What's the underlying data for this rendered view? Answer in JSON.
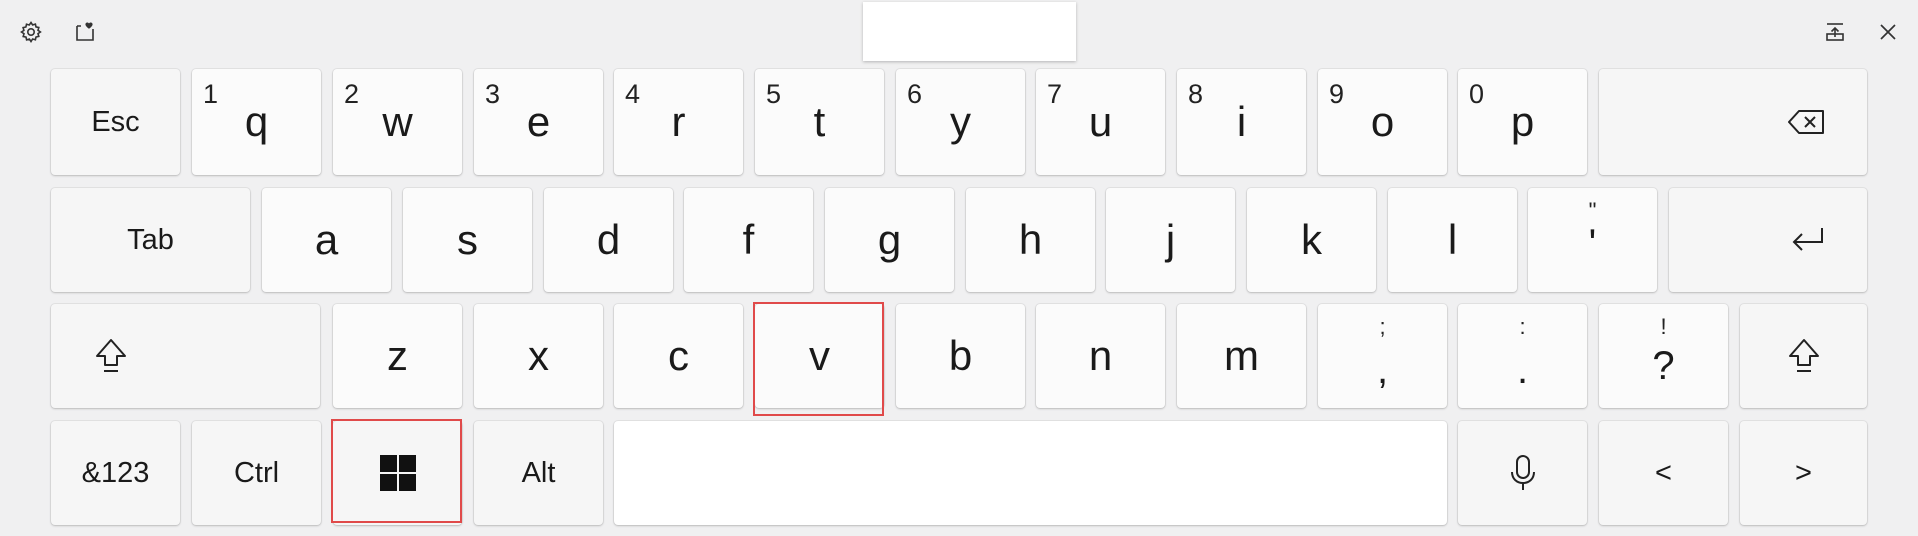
{
  "toolbar": {
    "settings_icon": "gear-icon",
    "emoji_icon": "heart-clipboard-icon",
    "undock_icon": "undock-icon",
    "close_icon": "close-icon"
  },
  "keyboard": {
    "row1": {
      "esc": "Esc",
      "q": "q",
      "q_alt": "1",
      "w": "w",
      "w_alt": "2",
      "e": "e",
      "e_alt": "3",
      "r": "r",
      "r_alt": "4",
      "t": "t",
      "t_alt": "5",
      "y": "y",
      "y_alt": "6",
      "u": "u",
      "u_alt": "7",
      "i": "i",
      "i_alt": "8",
      "o": "o",
      "o_alt": "9",
      "p": "p",
      "p_alt": "0",
      "backspace_icon": "backspace-icon"
    },
    "row2": {
      "tab": "Tab",
      "a": "a",
      "s": "s",
      "d": "d",
      "f": "f",
      "g": "g",
      "h": "h",
      "j": "j",
      "k": "k",
      "l": "l",
      "apostrophe": "'",
      "apostrophe_alt": "\"",
      "enter_icon": "enter-icon"
    },
    "row3": {
      "shift_icon": "shift-icon",
      "z": "z",
      "x": "x",
      "c": "c",
      "v": "v",
      "b": "b",
      "n": "n",
      "m": "m",
      "comma": ",",
      "comma_alt": ";",
      "period": ".",
      "period_alt": ":",
      "question": "?",
      "question_alt": "!"
    },
    "row4": {
      "symbols": "&123",
      "ctrl": "Ctrl",
      "windows_icon": "windows-logo-icon",
      "alt": "Alt",
      "mic_icon": "microphone-icon",
      "left": "<",
      "right": ">"
    }
  },
  "colors": {
    "background": "#f0f0f1",
    "key": "#fbfbfb",
    "highlight": "#e04a4a"
  }
}
